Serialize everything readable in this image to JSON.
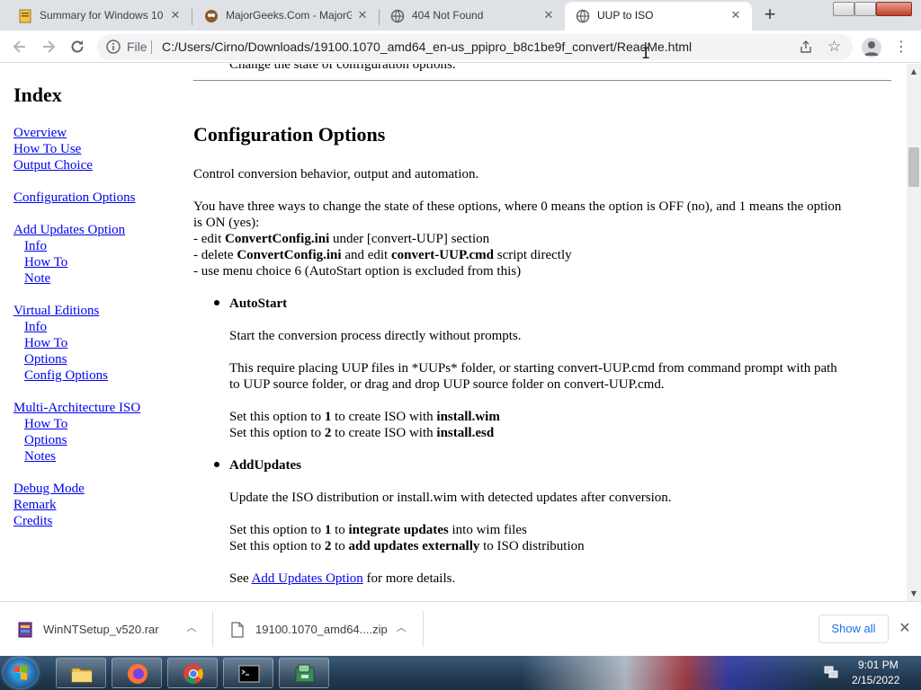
{
  "browser": {
    "tabs": [
      {
        "title": "Summary for Windows 10",
        "icon": "page-icon",
        "active": false
      },
      {
        "title": "MajorGeeks.Com - MajorG",
        "icon": "majorgeeks-icon",
        "active": false
      },
      {
        "title": "404 Not Found",
        "icon": "globe-icon",
        "active": false
      },
      {
        "title": "UUP to ISO",
        "icon": "globe-icon",
        "active": true
      }
    ],
    "new_tab_symbol": "+",
    "omnibox": {
      "scheme_label": "File",
      "url": "C:/Users/Cirno/Downloads/19100.1070_amd64_en-us_ppipro_b8c1be9f_convert/ReadMe.html"
    }
  },
  "sidebar": {
    "heading": "Index",
    "groups": [
      {
        "items": [
          {
            "label": "Overview",
            "sub": false
          },
          {
            "label": "How To Use",
            "sub": false
          },
          {
            "label": "Output Choice",
            "sub": false
          }
        ]
      },
      {
        "items": [
          {
            "label": "Configuration Options",
            "sub": false
          }
        ]
      },
      {
        "items": [
          {
            "label": "Add Updates Option",
            "sub": false
          },
          {
            "label": "Info",
            "sub": true
          },
          {
            "label": "How To",
            "sub": true
          },
          {
            "label": "Note",
            "sub": true
          }
        ]
      },
      {
        "items": [
          {
            "label": "Virtual Editions",
            "sub": false
          },
          {
            "label": "Info",
            "sub": true
          },
          {
            "label": "How To",
            "sub": true
          },
          {
            "label": "Options",
            "sub": true
          },
          {
            "label": "Config Options",
            "sub": true
          }
        ]
      },
      {
        "items": [
          {
            "label": "Multi-Architecture ISO",
            "sub": false
          },
          {
            "label": "How To",
            "sub": true
          },
          {
            "label": "Options",
            "sub": true
          },
          {
            "label": "Notes",
            "sub": true
          }
        ]
      },
      {
        "items": [
          {
            "label": "Debug Mode",
            "sub": false
          },
          {
            "label": "Remark",
            "sub": false
          },
          {
            "label": "Credits",
            "sub": false
          }
        ]
      }
    ]
  },
  "content": {
    "cut_line": "Change the state of configuration options.",
    "section_title": "Configuration Options",
    "intro": "Control conversion behavior, output and automation.",
    "ways": {
      "line1a": "You have three ways to change the state of these options, where 0 means the option is OFF (no), and 1 means the option",
      "line1b": "is ON (yes):",
      "w1_pre": "- edit ",
      "w1_bold": "ConvertConfig.ini",
      "w1_post": " under [convert-UUP] section",
      "w2_pre": "- delete ",
      "w2_bold1": "ConvertConfig.ini",
      "w2_mid": " and edit ",
      "w2_bold2": "convert-UUP.cmd",
      "w2_post": " script directly",
      "w3": "- use menu choice 6 (AutoStart option is excluded from this)"
    },
    "autostart": {
      "title": "AutoStart",
      "desc": "Start the conversion process directly without prompts.",
      "req_a": "This require placing UUP files in *UUPs* folder, or starting convert-UUP.cmd from command prompt with path",
      "req_b": "to UUP source folder, or drag and drop UUP source folder on convert-UUP.cmd.",
      "o1_pre": "Set this option to ",
      "o1_num": "1",
      "o1_mid": " to create ISO with ",
      "o1_bold": "install.wim",
      "o2_pre": "Set this option to ",
      "o2_num": "2",
      "o2_mid": " to create ISO with ",
      "o2_bold": "install.esd"
    },
    "addupdates": {
      "title": "AddUpdates",
      "desc": "Update the ISO distribution or install.wim with detected updates after conversion.",
      "o1_pre": "Set this option to ",
      "o1_num": "1",
      "o1_mid": " to ",
      "o1_bold": "integrate updates",
      "o1_post": " into wim files",
      "o2_pre": "Set this option to ",
      "o2_num": "2",
      "o2_mid": " to ",
      "o2_bold": "add updates externally",
      "o2_post": " to ISO distribution",
      "see_pre": "See ",
      "see_link": "Add Updates Option",
      "see_post": " for more details."
    }
  },
  "downloads": {
    "items": [
      {
        "name": "WinNTSetup_v520.rar",
        "icon": "rar-archive-icon"
      },
      {
        "name": "19100.1070_amd64....zip",
        "icon": "file-icon"
      }
    ],
    "show_all_label": "Show all",
    "close_symbol": "✕"
  },
  "taskbar": {
    "apps": [
      {
        "name": "explorer",
        "icon": "folder-icon"
      },
      {
        "name": "firefox",
        "icon": "firefox-icon"
      },
      {
        "name": "chrome",
        "icon": "chrome-icon"
      },
      {
        "name": "cmd",
        "icon": "cmd-icon"
      },
      {
        "name": "installer",
        "icon": "installer-icon"
      }
    ],
    "clock": {
      "time": "9:01 PM",
      "date": "2/15/2022"
    }
  }
}
